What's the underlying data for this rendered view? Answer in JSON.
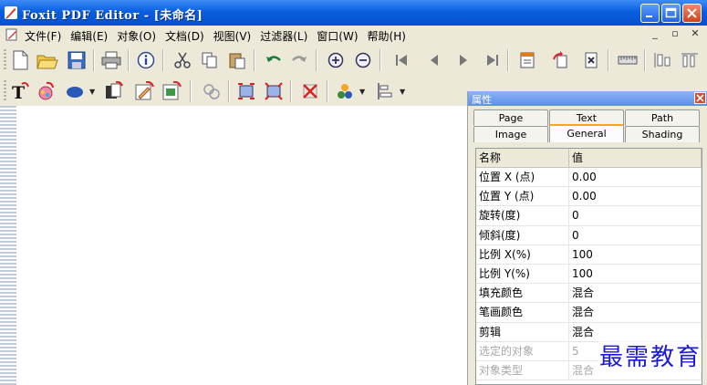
{
  "window": {
    "title": "Foxit PDF Editor - [未命名]"
  },
  "menu": {
    "items": [
      "文件(F)",
      "编辑(E)",
      "对象(O)",
      "文档(D)",
      "视图(V)",
      "过滤器(L)",
      "窗口(W)",
      "帮助(H)"
    ],
    "mdi_buttons": [
      "_",
      "▫",
      "✕"
    ]
  },
  "properties_panel": {
    "title": "属性",
    "tabs": [
      "Page",
      "Text",
      "Path",
      "Image",
      "General",
      "Shading"
    ],
    "active_tab": "General",
    "columns": [
      "名称",
      "值"
    ],
    "rows": [
      {
        "name": "位置 X (点)",
        "value": "0.00"
      },
      {
        "name": "位置 Y (点)",
        "value": "0.00"
      },
      {
        "name": "旋转(度)",
        "value": "0"
      },
      {
        "name": "倾斜(度)",
        "value": "0"
      },
      {
        "name": "比例 X(%)",
        "value": "100"
      },
      {
        "name": "比例 Y(%)",
        "value": "100"
      },
      {
        "name": "填充颜色",
        "value": "混合"
      },
      {
        "name": "笔画颜色",
        "value": "混合"
      },
      {
        "name": "剪辑",
        "value": "混合"
      },
      {
        "name": "选定的对象",
        "value": "5"
      },
      {
        "name": "对象类型",
        "value": "混合"
      }
    ]
  },
  "watermark": "最需教育",
  "colors": {
    "titlebar": "#0a5fe0",
    "active_tab_accent": "#f5a623",
    "watermark": "#1a1ad8"
  }
}
